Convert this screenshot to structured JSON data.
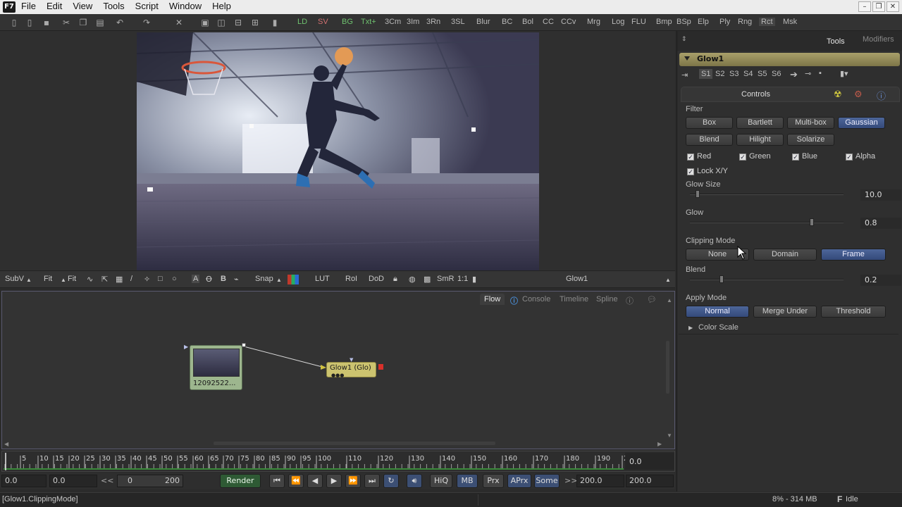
{
  "menubar": {
    "logo": "F7",
    "menus": [
      "File",
      "Edit",
      "View",
      "Tools",
      "Script",
      "Window",
      "Help"
    ]
  },
  "toolbar": {
    "tools": [
      "LD",
      "SV",
      "BG",
      "Txt+",
      "3Cm",
      "3Im",
      "3Rn",
      "3SL",
      "Blur",
      "BC",
      "Bol",
      "CC",
      "CCv",
      "Mrg",
      "Log",
      "FLU",
      "Bmp",
      "BSp",
      "Elp",
      "Ply",
      "Rng",
      "Rct",
      "Msk"
    ],
    "colors": {
      "LD": "#6fc26f",
      "SV": "#d07070",
      "BG": "#6fc26f",
      "Txt+": "#6fc26f"
    }
  },
  "viewer_bar": {
    "subv": "SubV",
    "fit1": "Fit",
    "fit2": "Fit",
    "snap": "Snap",
    "lut": "LUT",
    "roi": "RoI",
    "dod": "DoD",
    "smr": "SmR",
    "ratio": "1:1",
    "view_name": "Glow1"
  },
  "flow": {
    "tabs": [
      "Flow",
      "Console",
      "Timeline",
      "Spline"
    ],
    "loader_label": "12092522...",
    "glow_label": "Glow1  (Glo)"
  },
  "timeline": {
    "ticks": [
      "5",
      "10",
      "15",
      "20",
      "25",
      "30",
      "35",
      "40",
      "45",
      "50",
      "55",
      "60",
      "65",
      "70",
      "75",
      "80",
      "85",
      "90",
      "95",
      "100",
      "110",
      "120",
      "130",
      "140",
      "150",
      "160",
      "170",
      "180",
      "190",
      "2"
    ],
    "current": "0.0"
  },
  "transport": {
    "start": "0.0",
    "start2": "0.0",
    "range_start": "0",
    "range_end": "200",
    "render": "Render",
    "hiq": "HiQ",
    "mb": "MB",
    "prx": "Prx",
    "aprx": "APrx",
    "some": "Some",
    "end1": "200.0",
    "end2": "200.0"
  },
  "right_panel": {
    "tabs": {
      "tools": "Tools",
      "modifiers": "Modifiers"
    },
    "tool_name": "Glow1",
    "slots": [
      "S1",
      "S2",
      "S3",
      "S4",
      "S5",
      "S6"
    ],
    "controls_tab": "Controls",
    "filter": {
      "label": "Filter",
      "buttons": [
        "Box",
        "Bartlett",
        "Multi-box",
        "Gaussian",
        "Blend",
        "Hilight",
        "Solarize"
      ],
      "selected": "Gaussian"
    },
    "channels": {
      "red": "Red",
      "green": "Green",
      "blue": "Blue",
      "alpha": "Alpha",
      "lock": "Lock X/Y"
    },
    "glow_size": {
      "label": "Glow Size",
      "value": "10.0",
      "level": 0.04
    },
    "glow": {
      "label": "Glow",
      "value": "0.8",
      "level": 0.8
    },
    "clipping": {
      "label": "Clipping Mode",
      "buttons": [
        "None",
        "Domain",
        "Frame"
      ],
      "selected": "Frame"
    },
    "blend": {
      "label": "Blend",
      "value": "0.2",
      "level": 0.2
    },
    "apply_mode": {
      "label": "Apply Mode",
      "buttons": [
        "Normal",
        "Merge Under",
        "Threshold"
      ],
      "selected": "Normal"
    },
    "color_scale": "Color Scale"
  },
  "status": {
    "left": "[Glow1.ClippingMode]",
    "memory": "8% - 314 MB",
    "state": "Idle",
    "state_icon": "F"
  }
}
